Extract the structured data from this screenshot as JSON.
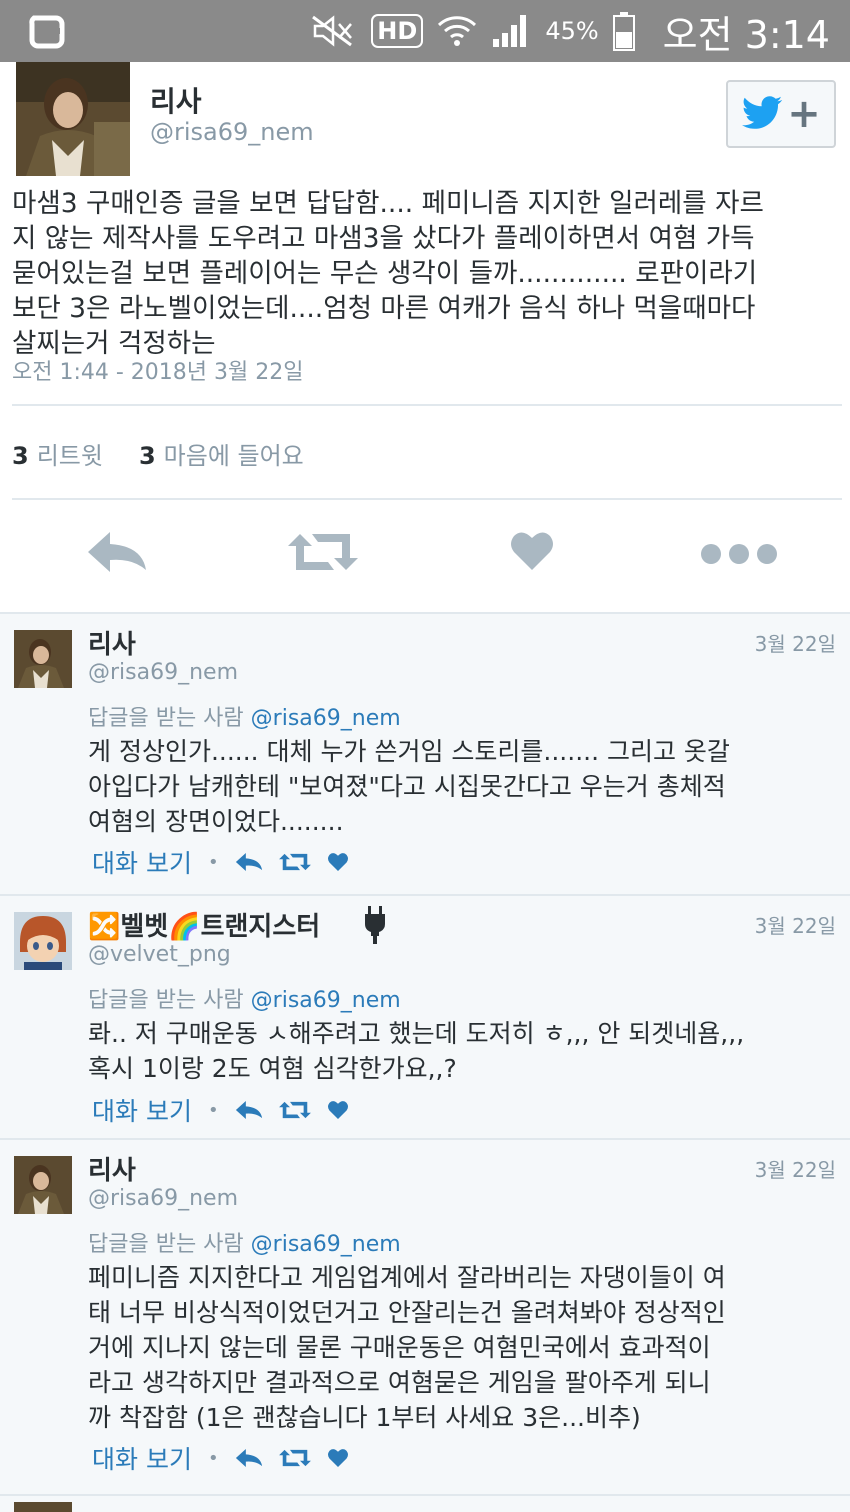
{
  "status_bar": {
    "battery": "45%",
    "time": "오전 3:14",
    "net_label": "HD"
  },
  "main_tweet": {
    "name": "리사",
    "handle": "@risa69_nem",
    "text": "마샘3 구매인증 글을 보면 답답함.... 페미니즘 지지한 일러레를 자르\n지 않는 제작사를 도우려고 마샘3을 샀다가 플레이하면서 여혐 가득\n묻어있는걸 보면 플레이어는 무슨 생각이 들까............. 로판이라기\n보단 3은 라노벨이었는데....엄청 마른 여캐가 음식 하나 먹을때마다\n살찌는거 걱정하는",
    "timestamp": "오전 1:44 - 2018년 3월 22일",
    "retweets_count": "3",
    "retweets_label": "리트윗",
    "likes_count": "3",
    "likes_label": "마음에 들어요"
  },
  "replies": [
    {
      "name": "리사",
      "handle": "@risa69_nem",
      "date": "3월 22일",
      "reply_prefix": "답글을 받는 사람",
      "reply_to": "@risa69_nem",
      "text": "게 정상인가...... 대체 누가 쓴거임 스토리를....... 그리고 옷갈\n아입다가 남캐한테 \"보여졌\"다고 시집못간다고 우는거 총체적\n여혐의 장면이었다........",
      "view": "대화 보기"
    },
    {
      "name": "🔀벨벳🌈트랜지스터",
      "handle": "@velvet_png",
      "date": "3월 22일",
      "reply_prefix": "답글을 받는 사람",
      "reply_to": "@risa69_nem",
      "text": "롸.. 저 구매운동 ㅅ해주려고 했는데 도저히 ㅎ,,, 안 되겟네욤,,,\n혹시 1이랑 2도 여혐 심각한가요,,?",
      "view": "대화 보기"
    },
    {
      "name": "리사",
      "handle": "@risa69_nem",
      "date": "3월 22일",
      "reply_prefix": "답글을 받는 사람",
      "reply_to": "@risa69_nem",
      "text": "페미니즘 지지한다고 게임업계에서 잘라버리는 자댕이들이 여\n태 너무 비상식적이었던거고 안잘리는건 올려쳐봐야 정상적인\n거에 지나지 않는데 물론 구매운동은 여혐민국에서 효과적이\n라고 생각하지만 결과적으로 여혐묻은 게임을 팔아주게 되니\n까 착잡함 (1은 괜찮습니다 1부터 사세요 3은...비추)",
      "view": "대화 보기"
    }
  ],
  "colors": {
    "twitter_blue": "#2b7bb9",
    "icon_gray": "#8899a6",
    "status_bar": "#8a8a8a"
  }
}
